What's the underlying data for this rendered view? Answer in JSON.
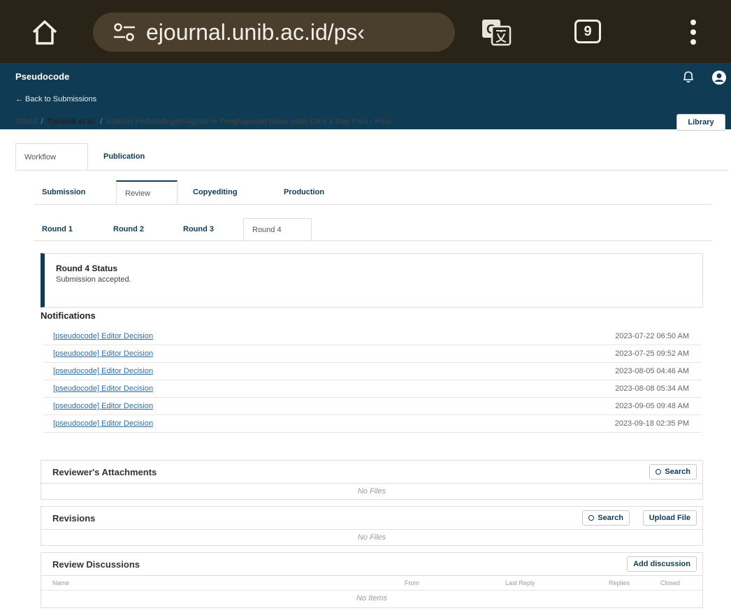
{
  "browser": {
    "url": "ejournal.unib.ac.id/ps‹",
    "tab_count": "9"
  },
  "header": {
    "journal": "Pseudocode",
    "back_link": "← Back to Submissions"
  },
  "breadcrumb": {
    "id": "28948",
    "separator": "/",
    "authors": "Tjahjadi et al.",
    "title": "Analisis Perbandingan Algoritme Penghapusan Noise pada Citra X-Ray Paru - Paru"
  },
  "library_label": "Library",
  "main_tabs": [
    {
      "label": "Workflow"
    },
    {
      "label": "Publication"
    }
  ],
  "stage_tabs": [
    {
      "label": "Submission"
    },
    {
      "label": "Review"
    },
    {
      "label": "Copyediting"
    },
    {
      "label": "Production"
    }
  ],
  "round_tabs": [
    {
      "label": "Round 1"
    },
    {
      "label": "Round 2"
    },
    {
      "label": "Round 3"
    },
    {
      "label": "Round 4"
    }
  ],
  "status": {
    "title": "Round 4 Status",
    "text": "Submission accepted."
  },
  "notifications": {
    "heading": "Notifications",
    "items": [
      {
        "label": "[pseudocode] Editor Decision",
        "date": "2023-07-22 06:50 AM"
      },
      {
        "label": "[pseudocode] Editor Decision",
        "date": "2023-07-25 09:52 AM"
      },
      {
        "label": "[pseudocode] Editor Decision",
        "date": "2023-08-05 04:46 AM"
      },
      {
        "label": "[pseudocode] Editor Decision",
        "date": "2023-08-08 05:34 AM"
      },
      {
        "label": "[pseudocode] Editor Decision",
        "date": "2023-09-05 09:48 AM"
      },
      {
        "label": "[pseudocode] Editor Decision",
        "date": "2023-09-18 02:35 PM"
      }
    ]
  },
  "reviewer_attachments": {
    "title": "Reviewer's Attachments",
    "search_label": "Search",
    "empty": "No Files"
  },
  "revisions": {
    "title": "Revisions",
    "search_label": "Search",
    "upload_label": "Upload File",
    "empty": "No Files"
  },
  "discussions": {
    "title": "Review Discussions",
    "add_label": "Add discussion",
    "columns": [
      "Name",
      "From",
      "Last Reply",
      "Replies",
      "Closed"
    ],
    "empty": "No Items"
  },
  "colors": {
    "header_bg": "#0f3b55",
    "browser_bg": "#2a2418",
    "link": "#2a6ea8"
  }
}
